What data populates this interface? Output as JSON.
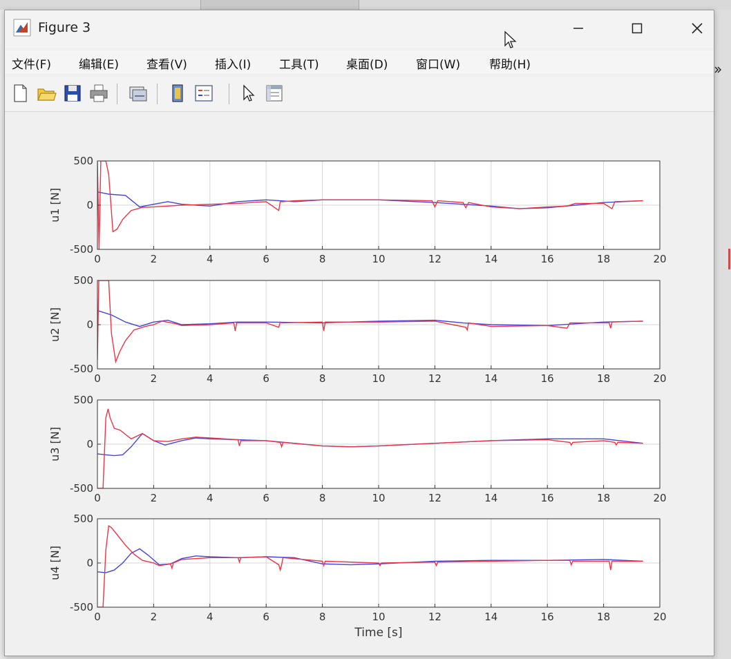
{
  "window": {
    "title": "Figure 3",
    "controls": {
      "minimize": "—",
      "maximize": "☐",
      "close": "✕"
    }
  },
  "menubar": {
    "items": [
      "文件(F)",
      "编辑(E)",
      "查看(V)",
      "插入(I)",
      "工具(T)",
      "桌面(D)",
      "窗口(W)",
      "帮助(H)"
    ],
    "overflow_icon": "chevron-double-icon"
  },
  "toolbar": {
    "buttons": [
      "new-figure-icon",
      "open-folder-icon",
      "save-icon",
      "print-icon",
      "link-icon",
      "dock-icon",
      "insert-legend-icon",
      "pointer-icon",
      "property-editor-icon"
    ]
  },
  "colors": {
    "series_reference": "#4444dd",
    "series_actual": "#ee3344",
    "axes": "#333333",
    "grid": "#d6d6d6"
  },
  "chart_data": [
    {
      "type": "line",
      "ylabel": "u1 [N]",
      "xlabel": "",
      "xlim": [
        0,
        20
      ],
      "ylim": [
        -500,
        500
      ],
      "xticks": [
        "0",
        "2",
        "4",
        "6",
        "8",
        "10",
        "12",
        "14",
        "16",
        "18",
        "20"
      ],
      "yticks": [
        "500",
        "0",
        "-500"
      ],
      "grid": true,
      "series": [
        {
          "color": "#4444dd",
          "x": [
            0,
            0.4,
            1.0,
            1.5,
            2.0,
            2.5,
            3.0,
            4.0,
            5.0,
            6.0,
            7.0,
            8.0,
            10.0,
            12.0,
            13.0,
            14.0,
            15.0,
            16.0,
            17.0,
            18.0,
            19.4
          ],
          "y": [
            150,
            125,
            110,
            -20,
            10,
            40,
            10,
            -10,
            40,
            60,
            40,
            60,
            60,
            30,
            10,
            -10,
            -40,
            -30,
            0,
            30,
            50
          ]
        },
        {
          "color": "#ee3344",
          "x": [
            0,
            0.06,
            0.12,
            0.2,
            0.3,
            0.4,
            0.55,
            0.7,
            0.9,
            1.2,
            1.6,
            2.0,
            2.5,
            3.0,
            3.5,
            4.0,
            5.0,
            6.0,
            6.45,
            6.5,
            6.6,
            7.0,
            8.0,
            10.0,
            11.9,
            12.0,
            12.1,
            13.0,
            13.1,
            13.2,
            14.0,
            15.0,
            16.0,
            16.7,
            17.0,
            18.0,
            18.3,
            18.4,
            19.4
          ],
          "y": [
            500,
            -500,
            500,
            500,
            500,
            350,
            -300,
            -270,
            -160,
            -60,
            -25,
            -20,
            -10,
            0,
            5,
            10,
            20,
            40,
            -60,
            40,
            40,
            50,
            60,
            60,
            50,
            -20,
            50,
            30,
            -30,
            30,
            -20,
            -40,
            -20,
            -10,
            20,
            20,
            -40,
            40,
            50
          ]
        }
      ]
    },
    {
      "type": "line",
      "ylabel": "u2 [N]",
      "xlabel": "",
      "xlim": [
        0,
        20
      ],
      "ylim": [
        -500,
        500
      ],
      "xticks": [
        "0",
        "2",
        "4",
        "6",
        "8",
        "10",
        "12",
        "14",
        "16",
        "18",
        "20"
      ],
      "yticks": [
        "500",
        "0",
        "-500"
      ],
      "grid": true,
      "series": [
        {
          "color": "#4444dd",
          "x": [
            0,
            0.5,
            1.0,
            1.5,
            2.0,
            2.5,
            3.0,
            4.0,
            5.0,
            6.0,
            8.0,
            10.0,
            12.0,
            13.0,
            14.0,
            16.0,
            18.0,
            19.4
          ],
          "y": [
            160,
            110,
            30,
            -20,
            30,
            50,
            0,
            10,
            30,
            30,
            20,
            40,
            50,
            20,
            0,
            -10,
            30,
            40
          ]
        },
        {
          "color": "#ee3344",
          "x": [
            0,
            0.05,
            0.12,
            0.2,
            0.3,
            0.4,
            0.5,
            0.65,
            0.8,
            1.0,
            1.3,
            1.7,
            2.0,
            2.3,
            2.8,
            3.0,
            4.0,
            4.85,
            4.9,
            4.95,
            6.0,
            6.45,
            6.5,
            6.55,
            8.0,
            8.05,
            8.1,
            10.0,
            12.0,
            13.1,
            13.15,
            13.2,
            14.0,
            16.0,
            16.7,
            16.75,
            16.8,
            18.2,
            18.25,
            18.3,
            19.4
          ],
          "y": [
            -400,
            500,
            500,
            500,
            500,
            500,
            -100,
            -420,
            -300,
            -180,
            -60,
            -20,
            0,
            40,
            10,
            -10,
            0,
            20,
            -70,
            20,
            20,
            -30,
            30,
            20,
            30,
            -70,
            30,
            30,
            40,
            -30,
            -60,
            20,
            -20,
            -10,
            -40,
            -10,
            20,
            20,
            -40,
            30,
            40
          ]
        }
      ]
    },
    {
      "type": "line",
      "ylabel": "u3 [N]",
      "xlabel": "",
      "xlim": [
        0,
        20
      ],
      "ylim": [
        -500,
        500
      ],
      "xticks": [
        "0",
        "2",
        "4",
        "6",
        "8",
        "10",
        "12",
        "14",
        "16",
        "18",
        "20"
      ],
      "yticks": [
        "500",
        "0",
        "-500"
      ],
      "grid": true,
      "series": [
        {
          "color": "#4444dd",
          "x": [
            0,
            0.3,
            0.6,
            0.9,
            1.2,
            1.6,
            2.0,
            2.4,
            3.0,
            3.5,
            4.0,
            5.0,
            6.0,
            7.0,
            8.0,
            9.0,
            10.0,
            12.0,
            14.0,
            16.0,
            18.0,
            19.4
          ],
          "y": [
            -110,
            -120,
            -130,
            -120,
            -30,
            120,
            40,
            -10,
            40,
            70,
            60,
            50,
            40,
            10,
            -20,
            -30,
            -20,
            10,
            40,
            60,
            60,
            10
          ]
        },
        {
          "color": "#ee3344",
          "x": [
            0,
            0.1,
            0.2,
            0.3,
            0.38,
            0.45,
            0.6,
            0.8,
            1.2,
            1.6,
            2.0,
            2.5,
            3.0,
            3.5,
            4.0,
            5.0,
            5.05,
            5.1,
            6.0,
            6.5,
            6.55,
            6.6,
            8.0,
            9.0,
            10.0,
            12.0,
            14.0,
            16.0,
            16.8,
            16.85,
            16.9,
            18.0,
            18.4,
            18.45,
            18.5,
            19.4
          ],
          "y": [
            -500,
            -500,
            -500,
            300,
            400,
            300,
            180,
            160,
            60,
            120,
            40,
            30,
            60,
            80,
            70,
            50,
            -20,
            40,
            40,
            20,
            -30,
            20,
            -20,
            -30,
            -20,
            10,
            40,
            50,
            20,
            -10,
            20,
            40,
            20,
            -10,
            20,
            10
          ]
        }
      ]
    },
    {
      "type": "line",
      "ylabel": "u4 [N]",
      "xlabel": "Time [s]",
      "xlim": [
        0,
        20
      ],
      "ylim": [
        -500,
        500
      ],
      "xticks": [
        "0",
        "2",
        "4",
        "6",
        "8",
        "10",
        "12",
        "14",
        "16",
        "18",
        "20"
      ],
      "yticks": [
        "500",
        "0",
        "-500"
      ],
      "grid": true,
      "series": [
        {
          "color": "#4444dd",
          "x": [
            0,
            0.3,
            0.6,
            0.9,
            1.2,
            1.5,
            1.8,
            2.2,
            2.6,
            3.0,
            3.5,
            4.0,
            5.0,
            6.0,
            7.0,
            8.0,
            9.0,
            10.0,
            12.0,
            14.0,
            16.0,
            18.0,
            19.4
          ],
          "y": [
            -100,
            -110,
            -80,
            0,
            110,
            160,
            90,
            -20,
            -10,
            50,
            80,
            70,
            60,
            70,
            60,
            -10,
            -20,
            -10,
            20,
            30,
            30,
            40,
            20
          ]
        },
        {
          "color": "#ee3344",
          "x": [
            0,
            0.1,
            0.2,
            0.3,
            0.4,
            0.5,
            0.7,
            1.0,
            1.3,
            1.6,
            2.0,
            2.2,
            2.6,
            2.65,
            2.7,
            3.0,
            4.0,
            5.0,
            5.05,
            5.1,
            6.0,
            6.45,
            6.5,
            6.55,
            6.6,
            8.0,
            8.05,
            8.1,
            10.0,
            10.05,
            10.1,
            12.0,
            12.05,
            12.1,
            14.0,
            16.0,
            16.8,
            16.85,
            16.9,
            18.2,
            18.25,
            18.3,
            19.4
          ],
          "y": [
            -500,
            -500,
            -500,
            150,
            420,
            400,
            320,
            200,
            100,
            30,
            0,
            -30,
            -10,
            -60,
            0,
            40,
            60,
            60,
            10,
            60,
            70,
            -20,
            -80,
            -20,
            60,
            20,
            -30,
            20,
            0,
            -30,
            0,
            10,
            -30,
            10,
            20,
            30,
            30,
            -20,
            20,
            20,
            -80,
            20,
            20
          ]
        }
      ]
    }
  ]
}
